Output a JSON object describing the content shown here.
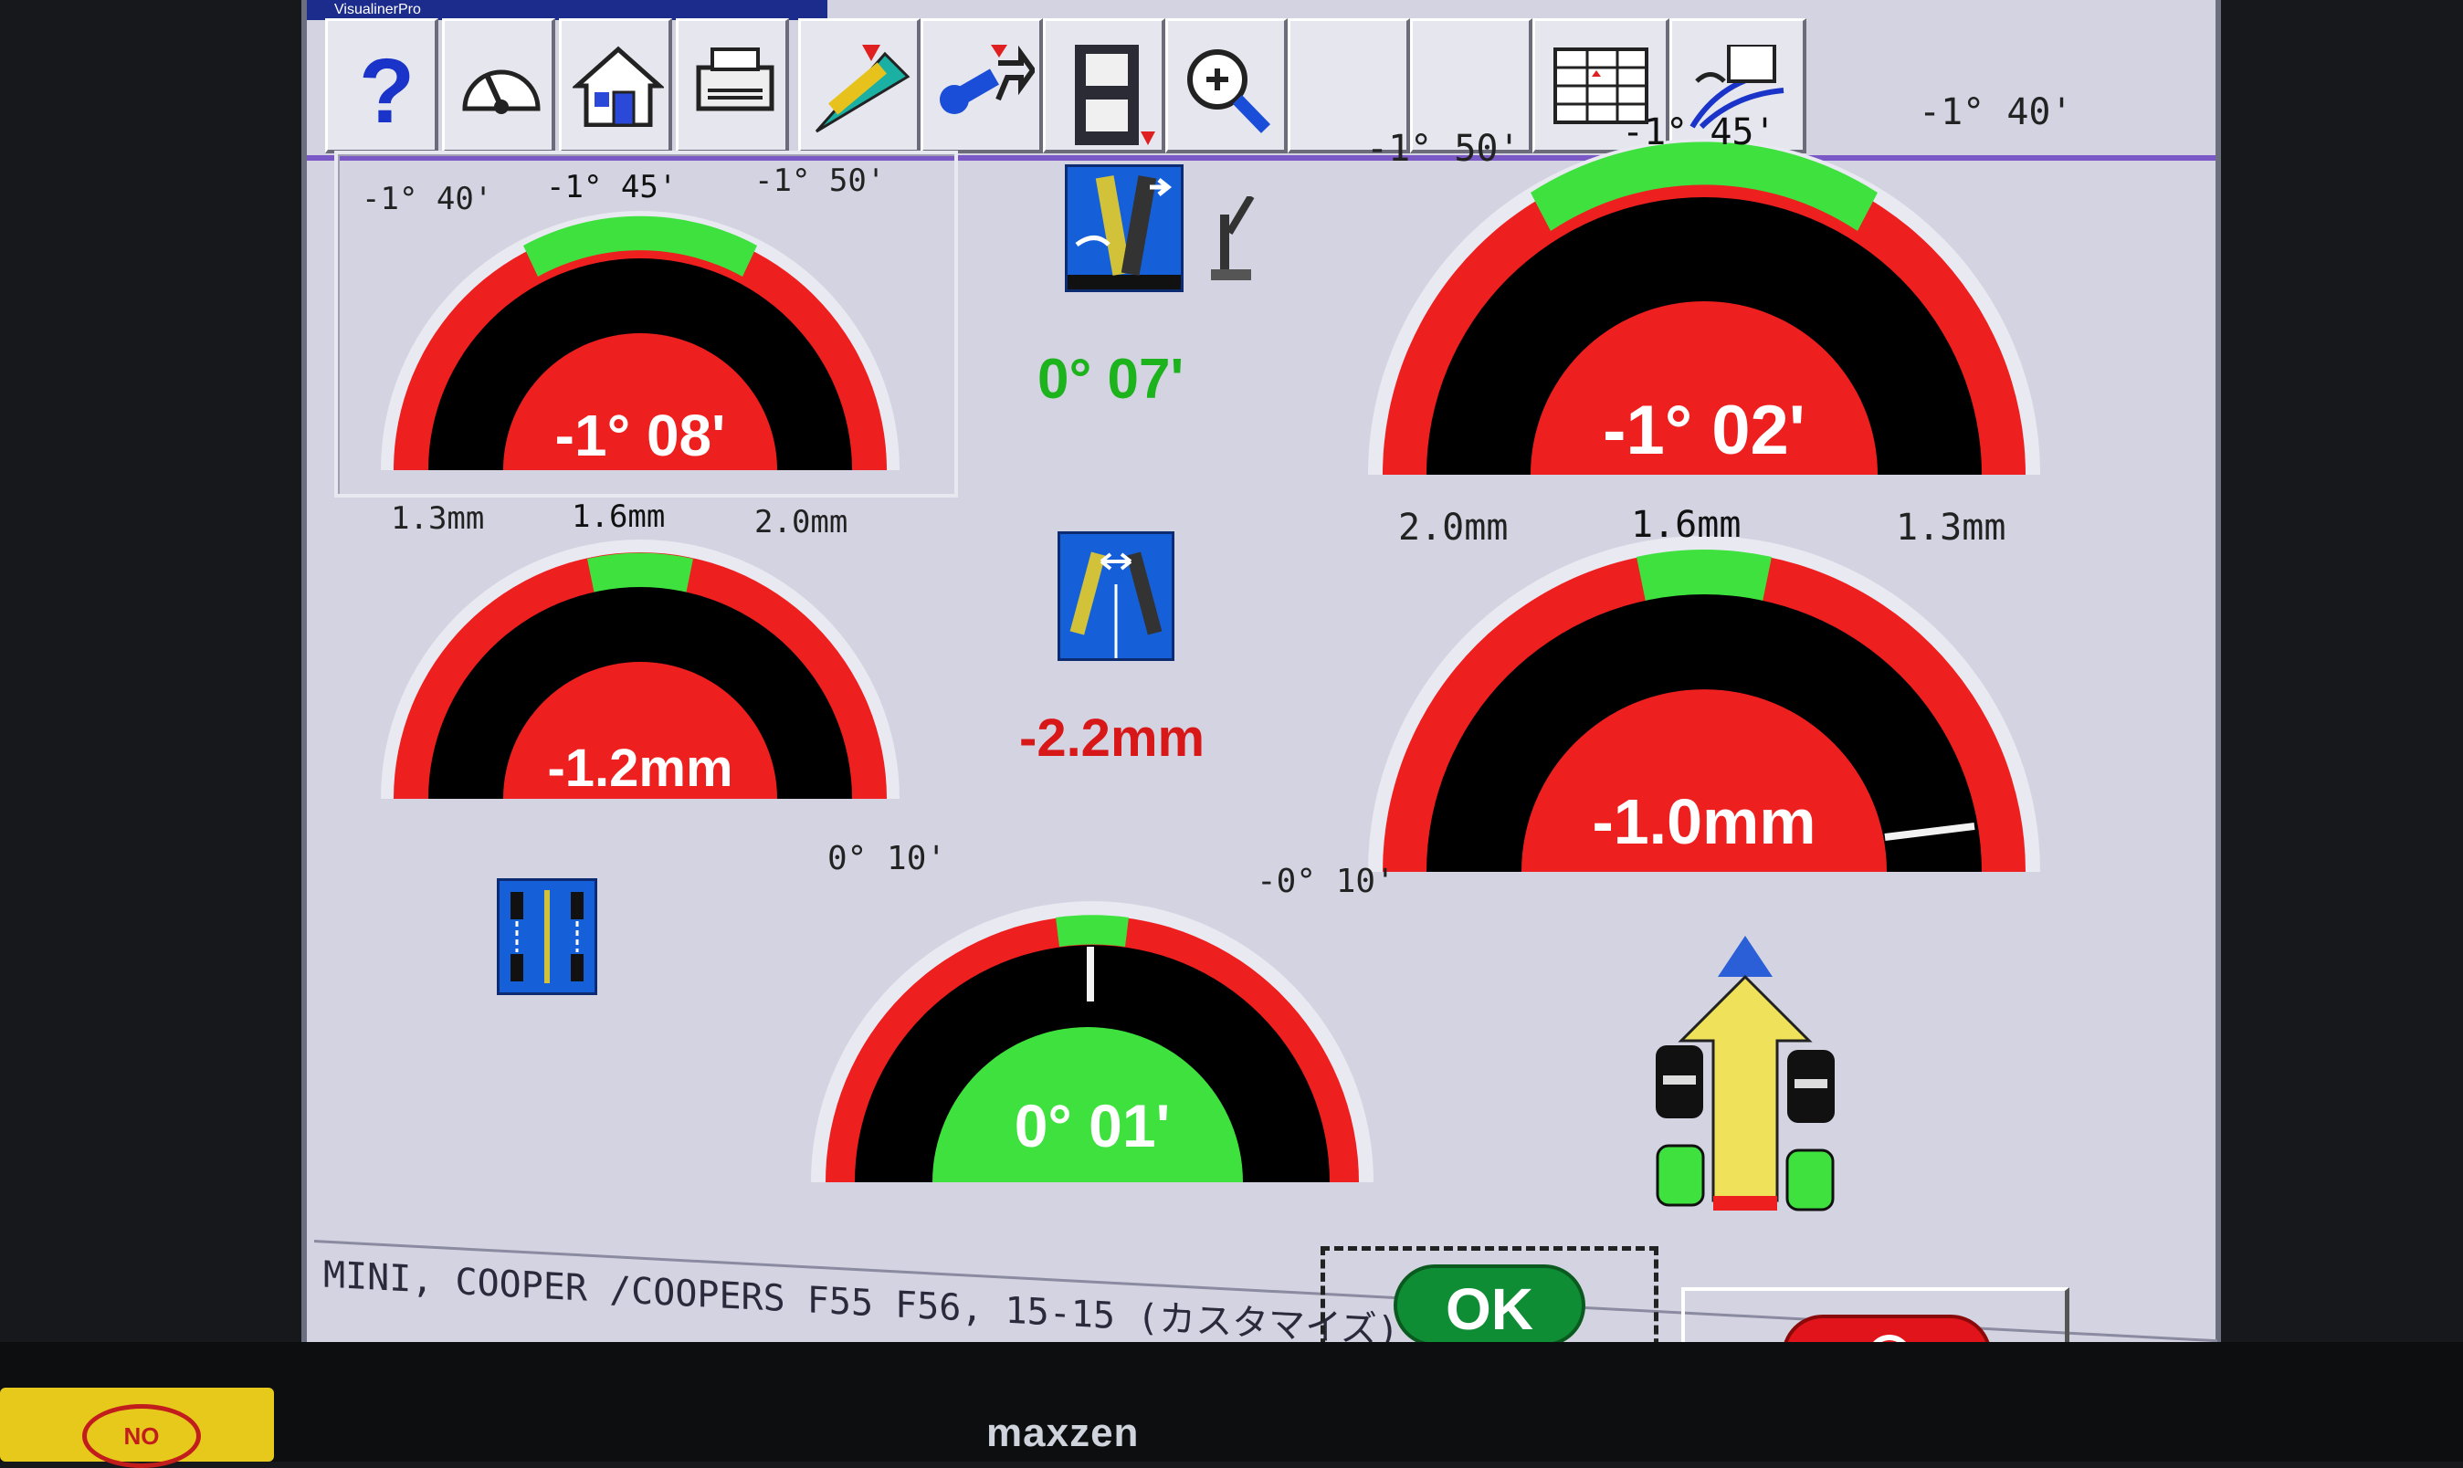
{
  "window": {
    "title": "VisualinerPro"
  },
  "toolbar": {
    "help_label": "?",
    "icons": [
      "help-icon",
      "gauge-icon",
      "home-icon",
      "printer-icon",
      "angle-tool-icon",
      "wrench-adjust-icon",
      "film-strip-icon",
      "zoom-in-icon",
      "spreadsheet-icon",
      "vehicle-spec-icon"
    ]
  },
  "gauges": {
    "front_left_camber": {
      "left_label": "-1° 40'",
      "mid_label": "-1° 45'",
      "right_label": "-1° 50'",
      "value": "-1° 08'",
      "status": "out_of_range"
    },
    "front_right_camber": {
      "left_label": "-1° 50'",
      "mid_label": "-1° 45'",
      "right_label": "-1° 40'",
      "value": "-1° 02'",
      "status": "out_of_range"
    },
    "front_left_toe": {
      "left_label": "1.3mm",
      "mid_label": "1.6mm",
      "right_label": "2.0mm",
      "value": "-1.2mm",
      "status": "out_of_range"
    },
    "front_right_toe": {
      "left_label": "2.0mm",
      "mid_label": "1.6mm",
      "right_label": "1.3mm",
      "value": "-1.0mm",
      "status": "out_of_range"
    },
    "thrust_angle": {
      "left_label": "0° 10'",
      "right_label": "-0° 10'",
      "value": "0° 01'",
      "status": "in_range"
    }
  },
  "center": {
    "cross_camber": {
      "value": "0° 07'",
      "color": "#1db31d"
    },
    "total_toe": {
      "value": "-2.2mm",
      "color": "#d81818"
    }
  },
  "status_bar": {
    "vehicle": "MINI, COOPER /COOPERS F55 F56, 15-15 (カスタマイズ)"
  },
  "buttons": {
    "ok_label": "OK",
    "cancel_icon": "no-entry-icon"
  },
  "bezel": {
    "brand": "maxzen",
    "sticker": "NO"
  },
  "colors": {
    "in_range": "#3fe13f",
    "out_of_range": "#ee1f1f",
    "gauge_face": "#000000",
    "screen_bg": "#d4d3e1"
  }
}
